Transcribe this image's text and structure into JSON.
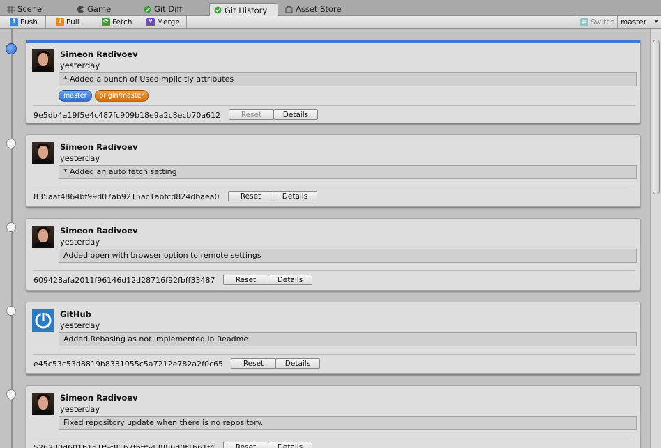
{
  "tabs": [
    {
      "label": "Scene",
      "icon": "grid-icon"
    },
    {
      "label": "Game",
      "icon": "pacman-icon"
    },
    {
      "label": "Git Diff",
      "icon": "check-icon"
    },
    {
      "label": "Git History",
      "icon": "check-icon",
      "active": true
    },
    {
      "label": "Asset Store",
      "icon": "store-icon"
    }
  ],
  "toolbar": {
    "push": "Push",
    "pull": "Pull",
    "fetch": "Fetch",
    "merge": "Merge",
    "switch": "Switch",
    "branch": "master"
  },
  "commits": [
    {
      "author": "Simeon Radivoev",
      "when": "yesterday",
      "message": "* Added a bunch of UsedImplicitly attributes",
      "hash": "9e5db4a19f5e4c487fc909b18e9a2c8ecb70a612",
      "reset": "Reset",
      "details": "Details",
      "tags": [
        "master",
        "origin/master"
      ],
      "avatar": "person"
    },
    {
      "author": "Simeon Radivoev",
      "when": "yesterday",
      "message": "* Added an auto fetch setting",
      "hash": "835aaf4864bf99d07ab9215ac1abfcd824dbaea0",
      "reset": "Reset",
      "details": "Details",
      "avatar": "person"
    },
    {
      "author": "Simeon Radivoev",
      "when": "yesterday",
      "message": "Added open with browser option to remote settings",
      "hash": "609428afa2011f96146d12d28716f92fbff33487",
      "reset": "Reset",
      "details": "Details",
      "avatar": "person"
    },
    {
      "author": "GitHub",
      "when": "yesterday",
      "message": "Added Rebasing as not implemented in Readme",
      "hash": "e45c53c53d8819b8331055c5a7212e782a2f0c65",
      "reset": "Reset",
      "details": "Details",
      "avatar": "github"
    },
    {
      "author": "Simeon Radivoev",
      "when": "yesterday",
      "message": "Fixed repository update when there is no repository.",
      "hash": "526280d601b1d1f5c81b7fbff543880d0f1b61f4",
      "reset": "Reset",
      "details": "Details",
      "avatar": "person"
    }
  ],
  "colors": {
    "accent": "#3d78d3",
    "tag_master": "#2f6fc8",
    "tag_origin": "#d0700f"
  }
}
